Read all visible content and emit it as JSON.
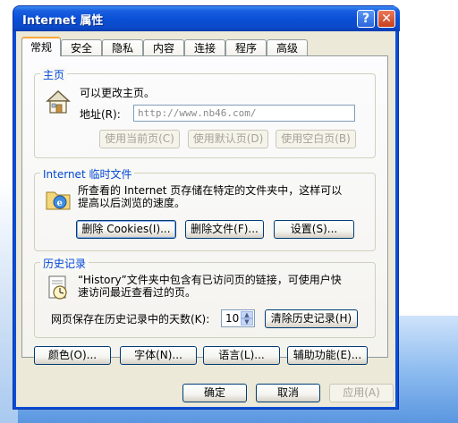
{
  "window": {
    "title": "Internet 属性",
    "help_glyph": "?",
    "close_glyph": "✕"
  },
  "tabs": [
    {
      "label": "常规",
      "active": true
    },
    {
      "label": "安全",
      "active": false
    },
    {
      "label": "隐私",
      "active": false
    },
    {
      "label": "内容",
      "active": false
    },
    {
      "label": "连接",
      "active": false
    },
    {
      "label": "程序",
      "active": false
    },
    {
      "label": "高级",
      "active": false
    }
  ],
  "home": {
    "group_title": "主页",
    "description": "可以更改主页。",
    "address_label": "地址(R):",
    "address_placeholder": "http://www.nb46.com/",
    "btn_use_current": "使用当前页(C)",
    "btn_use_default": "使用默认页(D)",
    "btn_use_blank": "使用空白页(B)"
  },
  "temp": {
    "group_title": "Internet 临时文件",
    "description_line1": "所查看的 Internet 页存储在特定的文件夹中，这样可以",
    "description_line2": "提高以后浏览的速度。",
    "btn_delete_cookies": "删除 Cookies(I)...",
    "btn_delete_files": "删除文件(F)...",
    "btn_settings": "设置(S)..."
  },
  "history": {
    "group_title": "历史记录",
    "description_line1": "“History”文件夹中包含有已访问页的链接，可使用户快",
    "description_line2": "速访问最近查看过的页。",
    "days_label": "网页保存在历史记录中的天数(K):",
    "days_value": "10",
    "btn_clear": "清除历史记录(H)"
  },
  "bottom_buttons": {
    "colors": "颜色(O)...",
    "fonts": "字体(N)...",
    "languages": "语言(L)...",
    "accessibility": "辅助功能(E)..."
  },
  "dialog_buttons": {
    "ok": "确定",
    "cancel": "取消",
    "apply": "应用(A)"
  },
  "colors": {
    "titlebar": "#0a4fd6",
    "group_title": "#0046d5",
    "dialog_bg": "#ece9d8",
    "active_tab_accent": "#f7a83b"
  }
}
